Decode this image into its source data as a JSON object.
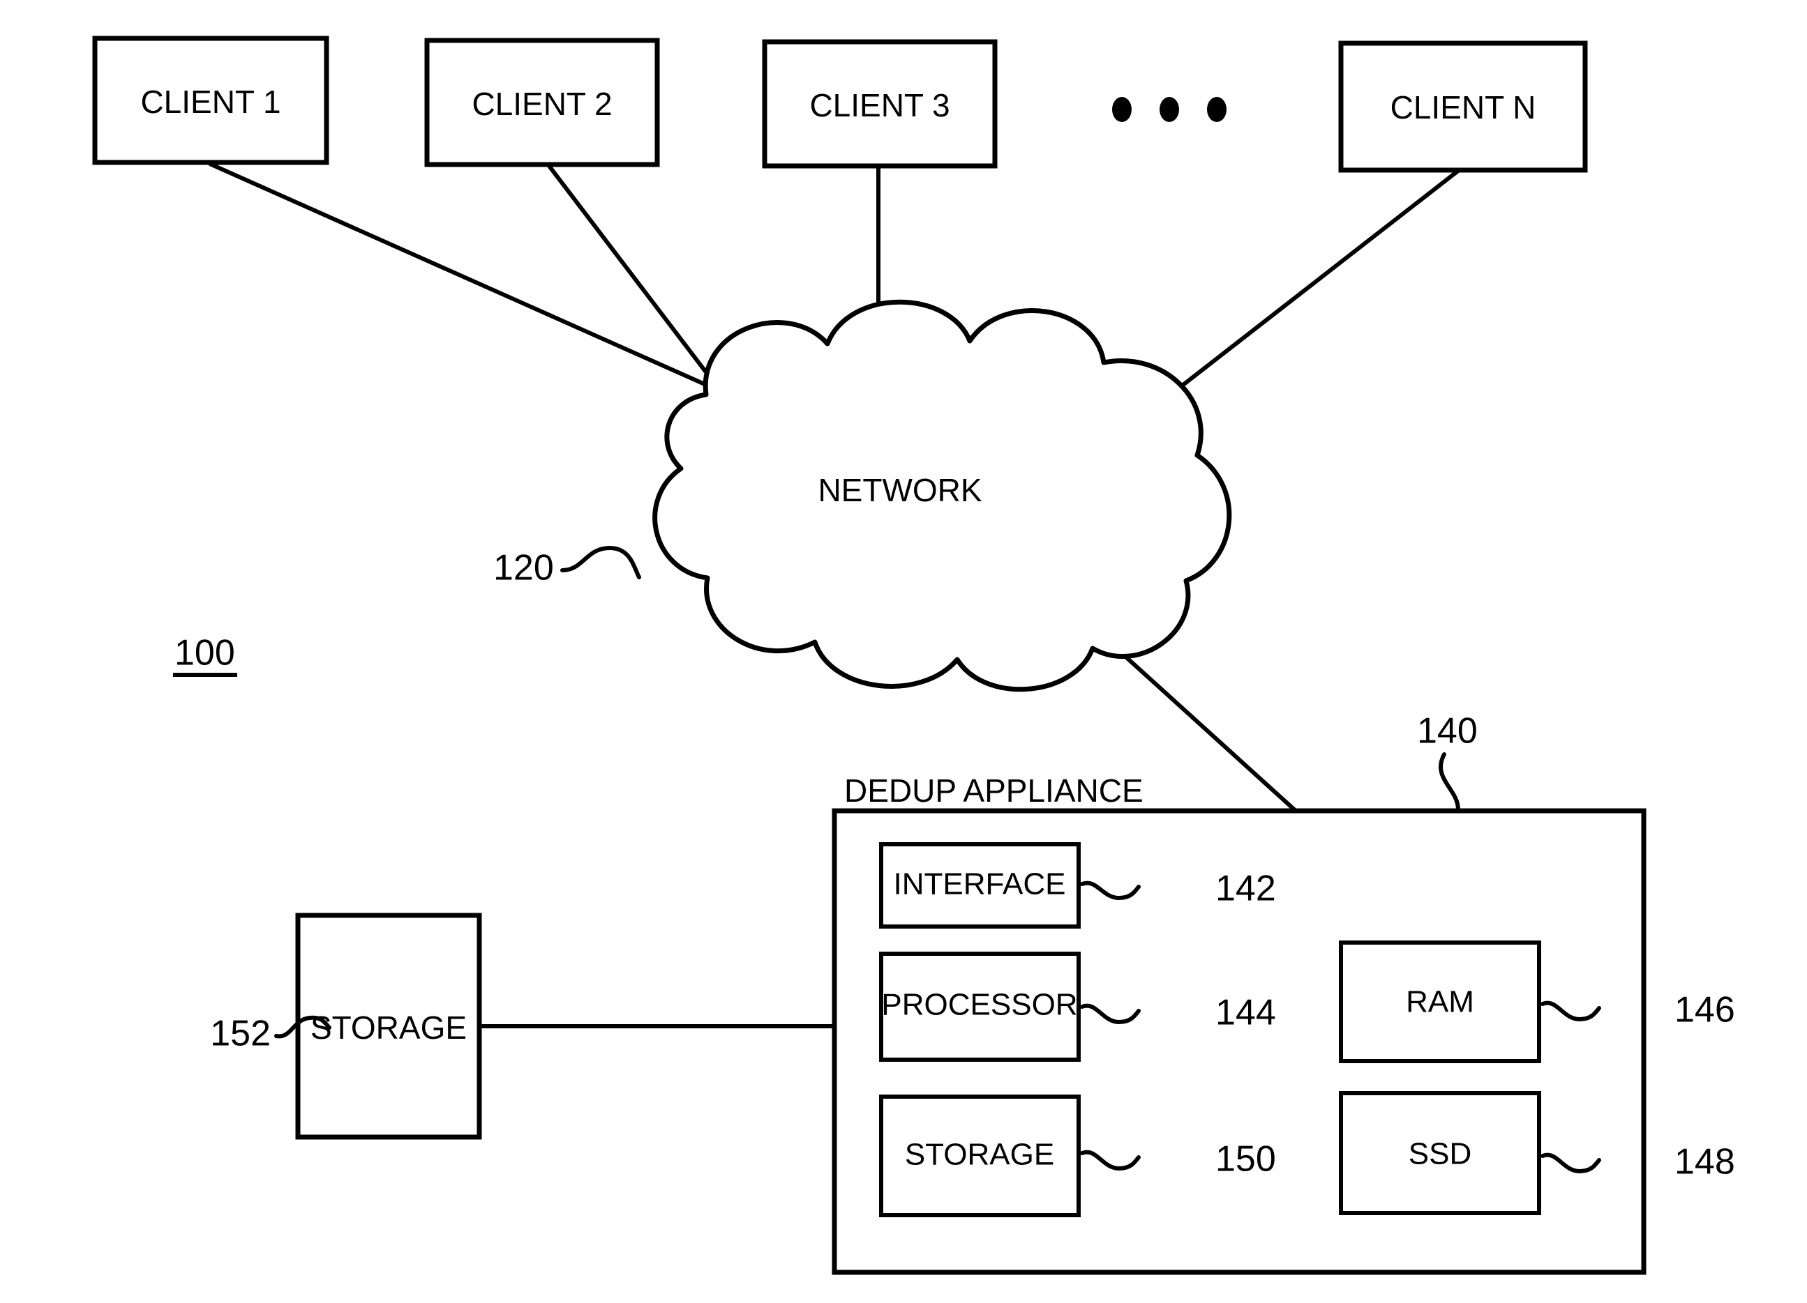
{
  "figure": {
    "figure_number": "100",
    "background_color": "#ffffff",
    "line_color": "#000000"
  },
  "clients": [
    {
      "label": "CLIENT 1",
      "ref": ""
    },
    {
      "label": "CLIENT 2",
      "ref": ""
    },
    {
      "label": "CLIENT 3",
      "ref": ""
    },
    {
      "label": "CLIENT N",
      "ref": ""
    }
  ],
  "ellipsis": "• • •",
  "network": {
    "label": "NETWORK",
    "ref": "120"
  },
  "appliance": {
    "title": "DEDUP APPLIANCE",
    "ref": "140",
    "components": [
      {
        "label": "INTERFACE",
        "ref": "142"
      },
      {
        "label": "PROCESSOR",
        "ref": "144"
      },
      {
        "label": "STORAGE",
        "ref": "150"
      },
      {
        "label": "RAM",
        "ref": "146"
      },
      {
        "label": "SSD",
        "ref": "148"
      }
    ]
  },
  "external_storage": {
    "label": "STORAGE",
    "ref": "152"
  }
}
